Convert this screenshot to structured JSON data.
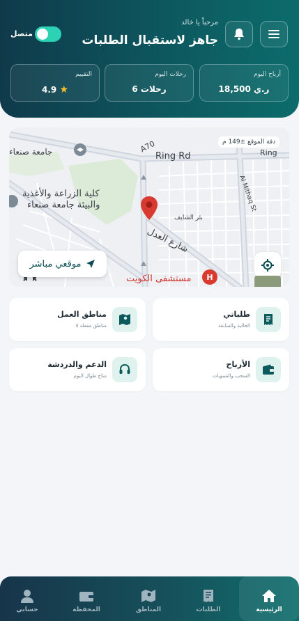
{
  "header": {
    "greeting": "مرحباً يا خالد",
    "headline": "جاهز لاستقبال الطلبات",
    "status_label": "متصل",
    "online": true
  },
  "stats": [
    {
      "label": "أرباح اليوم",
      "value": "18,500 ر.ي"
    },
    {
      "label": "رحلات اليوم",
      "value": "6 رحلات"
    },
    {
      "label": "التقييم",
      "value": "4.9"
    }
  ],
  "map": {
    "accuracy": "دقة الموقع ±149 م",
    "live_button": "موقعي مباشر",
    "labels": {
      "ring_rd": "Ring Rd",
      "ring_rd_2": "Ring",
      "a70": "A70",
      "mithaq": "Al Mithaq St",
      "university": "جامعة صنعاء",
      "agri_1": "كلية الزراعة والأغذية",
      "agri_2": "والبيئة جامعة صنعاء",
      "bir": "بئر الشايف",
      "adl": "شارع العدل",
      "hospital": "مستشفى الكويت"
    }
  },
  "cards": [
    {
      "title": "طلباتي",
      "subtitle": "الحالية والسابقة",
      "icon": "receipt-icon"
    },
    {
      "title": "مناطق العمل",
      "subtitle": "3 مناطق مفعلة",
      "icon": "map-icon"
    },
    {
      "title": "الأرباح",
      "subtitle": "السحب والتسويات",
      "icon": "wallet-icon"
    },
    {
      "title": "الدعم والدردشة",
      "subtitle": "متاح طوال اليوم",
      "icon": "headset-icon"
    }
  ],
  "nav": [
    {
      "label": "الرئيسية",
      "icon": "home-icon",
      "active": true
    },
    {
      "label": "الطلبات",
      "icon": "receipt-icon",
      "active": false
    },
    {
      "label": "المناطق",
      "icon": "map-icon",
      "active": false
    },
    {
      "label": "المحفظة",
      "icon": "wallet-icon",
      "active": false
    },
    {
      "label": "حسابي",
      "icon": "user-icon",
      "active": false
    }
  ],
  "colors": {
    "header_start": "#0f3a4a",
    "header_end": "#0c6c6b",
    "toggle_on": "#2bd3b4",
    "accent": "#0c4e55",
    "pin": "#d93a2f",
    "star": "#f4c12b"
  }
}
